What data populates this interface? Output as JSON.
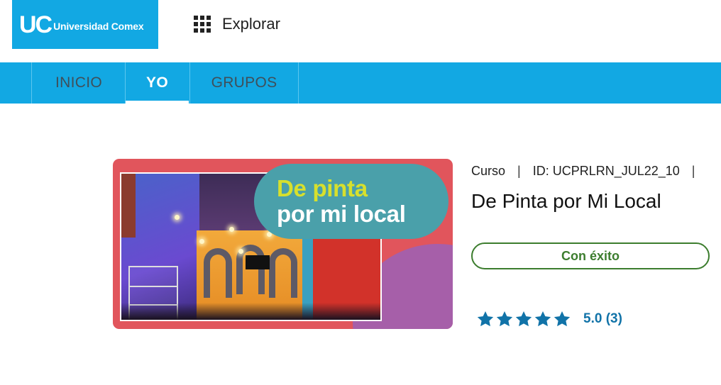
{
  "header": {
    "logo_mark": "UC",
    "logo_text": "Universidad Comex",
    "explore_label": "Explorar"
  },
  "nav": {
    "tabs": [
      {
        "label": "INICIO",
        "active": false
      },
      {
        "label": "YO",
        "active": true
      },
      {
        "label": "GRUPOS",
        "active": false
      }
    ]
  },
  "course": {
    "thumbnail": {
      "line1": "De pinta",
      "line2": "por mi local"
    },
    "type": "Curso",
    "id_label": "ID: UCPRLRN_JUL22_10",
    "trailing_separator": "|",
    "separator": "|",
    "title": "De Pinta por Mi Local",
    "status": "Con éxito",
    "rating": {
      "value": 5.0,
      "stars_filled": 5,
      "text": "5.0 (3)"
    }
  },
  "colors": {
    "brand_blue": "#12a8e3",
    "success_green": "#3c7d2e",
    "star_teal": "#1173a8",
    "thumb_red": "#e1555c",
    "bubble_teal": "#4aa0aa",
    "bubble_yellow": "#d7e02d"
  },
  "icons": {
    "explore": "grid-icon",
    "rating": "star-icon"
  }
}
